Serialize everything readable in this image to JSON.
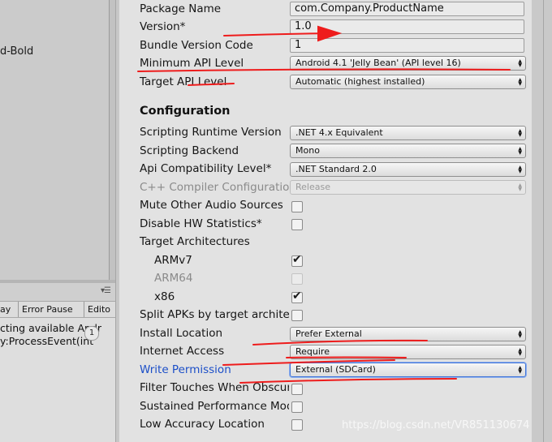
{
  "left_panel": {
    "font_fragment": "d-Bold",
    "console": {
      "tabs": [
        "ay",
        "Error Pause",
        "Edito"
      ],
      "lines": [
        "cting available Andr",
        "y:ProcessEvent(int"
      ],
      "count": "1"
    }
  },
  "player_settings": {
    "identification": {
      "package_name_label": "Package Name",
      "package_name_value": "com.Company.ProductName",
      "version_label": "Version*",
      "version_value": "1.0",
      "bundle_version_code_label": "Bundle Version Code",
      "bundle_version_code_value": "1",
      "min_api_label": "Minimum API Level",
      "min_api_value": "Android 4.1 'Jelly Bean' (API level 16)",
      "target_api_label": "Target API Level",
      "target_api_value": "Automatic (highest installed)"
    },
    "configuration": {
      "title": "Configuration",
      "scripting_runtime_label": "Scripting Runtime Version",
      "scripting_runtime_value": ".NET 4.x Equivalent",
      "scripting_backend_label": "Scripting Backend",
      "scripting_backend_value": "Mono",
      "api_compat_label": "Api Compatibility Level*",
      "api_compat_value": ".NET Standard 2.0",
      "cpp_compiler_label": "C++ Compiler Configuration",
      "cpp_compiler_value": "Release",
      "mute_audio_label": "Mute Other Audio Sources",
      "disable_hw_label": "Disable HW Statistics*",
      "target_arch_label": "Target Architectures",
      "armv7_label": "ARMv7",
      "arm64_label": "ARM64",
      "x86_label": "x86",
      "split_apks_label": "Split APKs by target architecture",
      "install_location_label": "Install Location",
      "install_location_value": "Prefer External",
      "internet_access_label": "Internet Access",
      "internet_access_value": "Require",
      "write_permission_label": "Write Permission",
      "write_permission_value": "External (SDCard)",
      "filter_touches_label": "Filter Touches When Obscured",
      "sustained_perf_label": "Sustained Performance Mode",
      "low_accuracy_label": "Low Accuracy Location"
    }
  },
  "checkbox_states": {
    "mute_audio": false,
    "disable_hw": false,
    "armv7": true,
    "arm64": false,
    "x86": true,
    "split_apks": false,
    "filter_touches": false,
    "sustained_perf": false,
    "low_accuracy": false
  },
  "icons": {
    "dropdown_arrow": "up-down-arrow-icon",
    "check": "checkmark-icon",
    "panel_menu": "panel-menu-icon"
  },
  "colors": {
    "annotation_red": "#ee1c1c",
    "link_blue": "#1c4fc8",
    "inspector_bg": "#e2e2e2"
  },
  "watermark": "https://blog.csdn.net/VR851130674"
}
